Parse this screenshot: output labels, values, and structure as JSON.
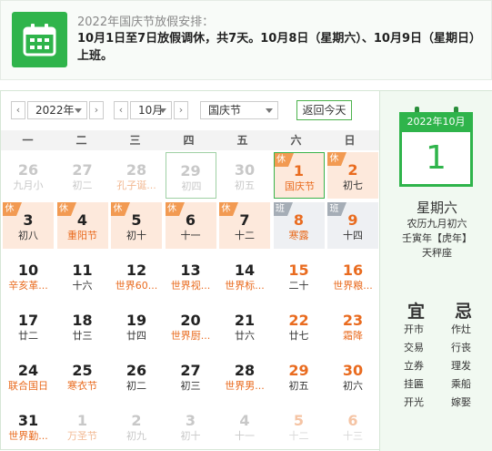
{
  "notice": {
    "title": "2022年国庆节放假安排：",
    "body": "10月1日至7日放假调休，共7天。10月8日（星期六）、10月9日（星期日）上班。"
  },
  "toolbar": {
    "year": "2022年",
    "month": "10月",
    "holiday": "国庆节",
    "today_label": "返回今天",
    "prev_icon": "chevron-left-icon",
    "next_icon": "chevron-right-icon"
  },
  "weekdays": [
    "一",
    "二",
    "三",
    "四",
    "五",
    "六",
    "日"
  ],
  "tags": {
    "rest": "休",
    "work": "班"
  },
  "colors": {
    "accent": "#2fb44b",
    "red": "#e96b1f",
    "holiday_bg": "#fde9dc",
    "workday_bg": "#eef0f3"
  },
  "days": [
    {
      "n": "26",
      "s": "九月小",
      "other": true
    },
    {
      "n": "27",
      "s": "初二",
      "other": true
    },
    {
      "n": "28",
      "s": "孔子诞...",
      "other": true,
      "fest": true
    },
    {
      "n": "29",
      "s": "初四",
      "other": true,
      "outline": true
    },
    {
      "n": "30",
      "s": "初五",
      "other": true
    },
    {
      "n": "1",
      "s": "国庆节",
      "tag": "rest",
      "bg": "holiday",
      "red": true,
      "fest": true,
      "selected": true
    },
    {
      "n": "2",
      "s": "初七",
      "tag": "rest",
      "bg": "holiday",
      "red": true
    },
    {
      "n": "3",
      "s": "初八",
      "tag": "rest",
      "bg": "holiday"
    },
    {
      "n": "4",
      "s": "重阳节",
      "tag": "rest",
      "bg": "holiday",
      "fest": true
    },
    {
      "n": "5",
      "s": "初十",
      "tag": "rest",
      "bg": "holiday"
    },
    {
      "n": "6",
      "s": "十一",
      "tag": "rest",
      "bg": "holiday"
    },
    {
      "n": "7",
      "s": "十二",
      "tag": "rest",
      "bg": "holiday"
    },
    {
      "n": "8",
      "s": "寒露",
      "tag": "work",
      "bg": "workday",
      "red": true,
      "fest": true
    },
    {
      "n": "9",
      "s": "十四",
      "tag": "work",
      "bg": "workday",
      "red": true
    },
    {
      "n": "10",
      "s": "辛亥革...",
      "fest": true
    },
    {
      "n": "11",
      "s": "十六"
    },
    {
      "n": "12",
      "s": "世界60...",
      "fest": true
    },
    {
      "n": "13",
      "s": "世界视...",
      "fest": true
    },
    {
      "n": "14",
      "s": "世界标...",
      "fest": true
    },
    {
      "n": "15",
      "s": "二十",
      "red": true
    },
    {
      "n": "16",
      "s": "世界粮...",
      "red": true,
      "fest": true
    },
    {
      "n": "17",
      "s": "廿二"
    },
    {
      "n": "18",
      "s": "廿三"
    },
    {
      "n": "19",
      "s": "廿四"
    },
    {
      "n": "20",
      "s": "世界厨...",
      "fest": true
    },
    {
      "n": "21",
      "s": "廿六"
    },
    {
      "n": "22",
      "s": "廿七",
      "red": true
    },
    {
      "n": "23",
      "s": "霜降",
      "red": true,
      "fest": true
    },
    {
      "n": "24",
      "s": "联合国日",
      "fest": true
    },
    {
      "n": "25",
      "s": "寒衣节",
      "fest": true
    },
    {
      "n": "26",
      "s": "初二"
    },
    {
      "n": "27",
      "s": "初三"
    },
    {
      "n": "28",
      "s": "世界男...",
      "fest": true
    },
    {
      "n": "29",
      "s": "初五",
      "red": true
    },
    {
      "n": "30",
      "s": "初六",
      "red": true
    },
    {
      "n": "31",
      "s": "世界勤...",
      "fest": true
    },
    {
      "n": "1",
      "s": "万圣节",
      "other": true,
      "fest": true
    },
    {
      "n": "2",
      "s": "初九",
      "other": true
    },
    {
      "n": "3",
      "s": "初十",
      "other": true
    },
    {
      "n": "4",
      "s": "十一",
      "other": true
    },
    {
      "n": "5",
      "s": "十二",
      "other": true,
      "redOther": true
    },
    {
      "n": "6",
      "s": "十三",
      "other": true,
      "redOther": true
    }
  ],
  "side": {
    "header": "2022年10月",
    "day": "1",
    "weekday": "星期六",
    "lunar": "农历九月初六",
    "ganzhi": "壬寅年【虎年】",
    "star": "天秤座",
    "yi_label": "宜",
    "ji_label": "忌",
    "yi": [
      "开市",
      "交易",
      "立券",
      "挂匾",
      "开光"
    ],
    "ji": [
      "作灶",
      "行丧",
      "理发",
      "乘船",
      "嫁娶"
    ]
  }
}
